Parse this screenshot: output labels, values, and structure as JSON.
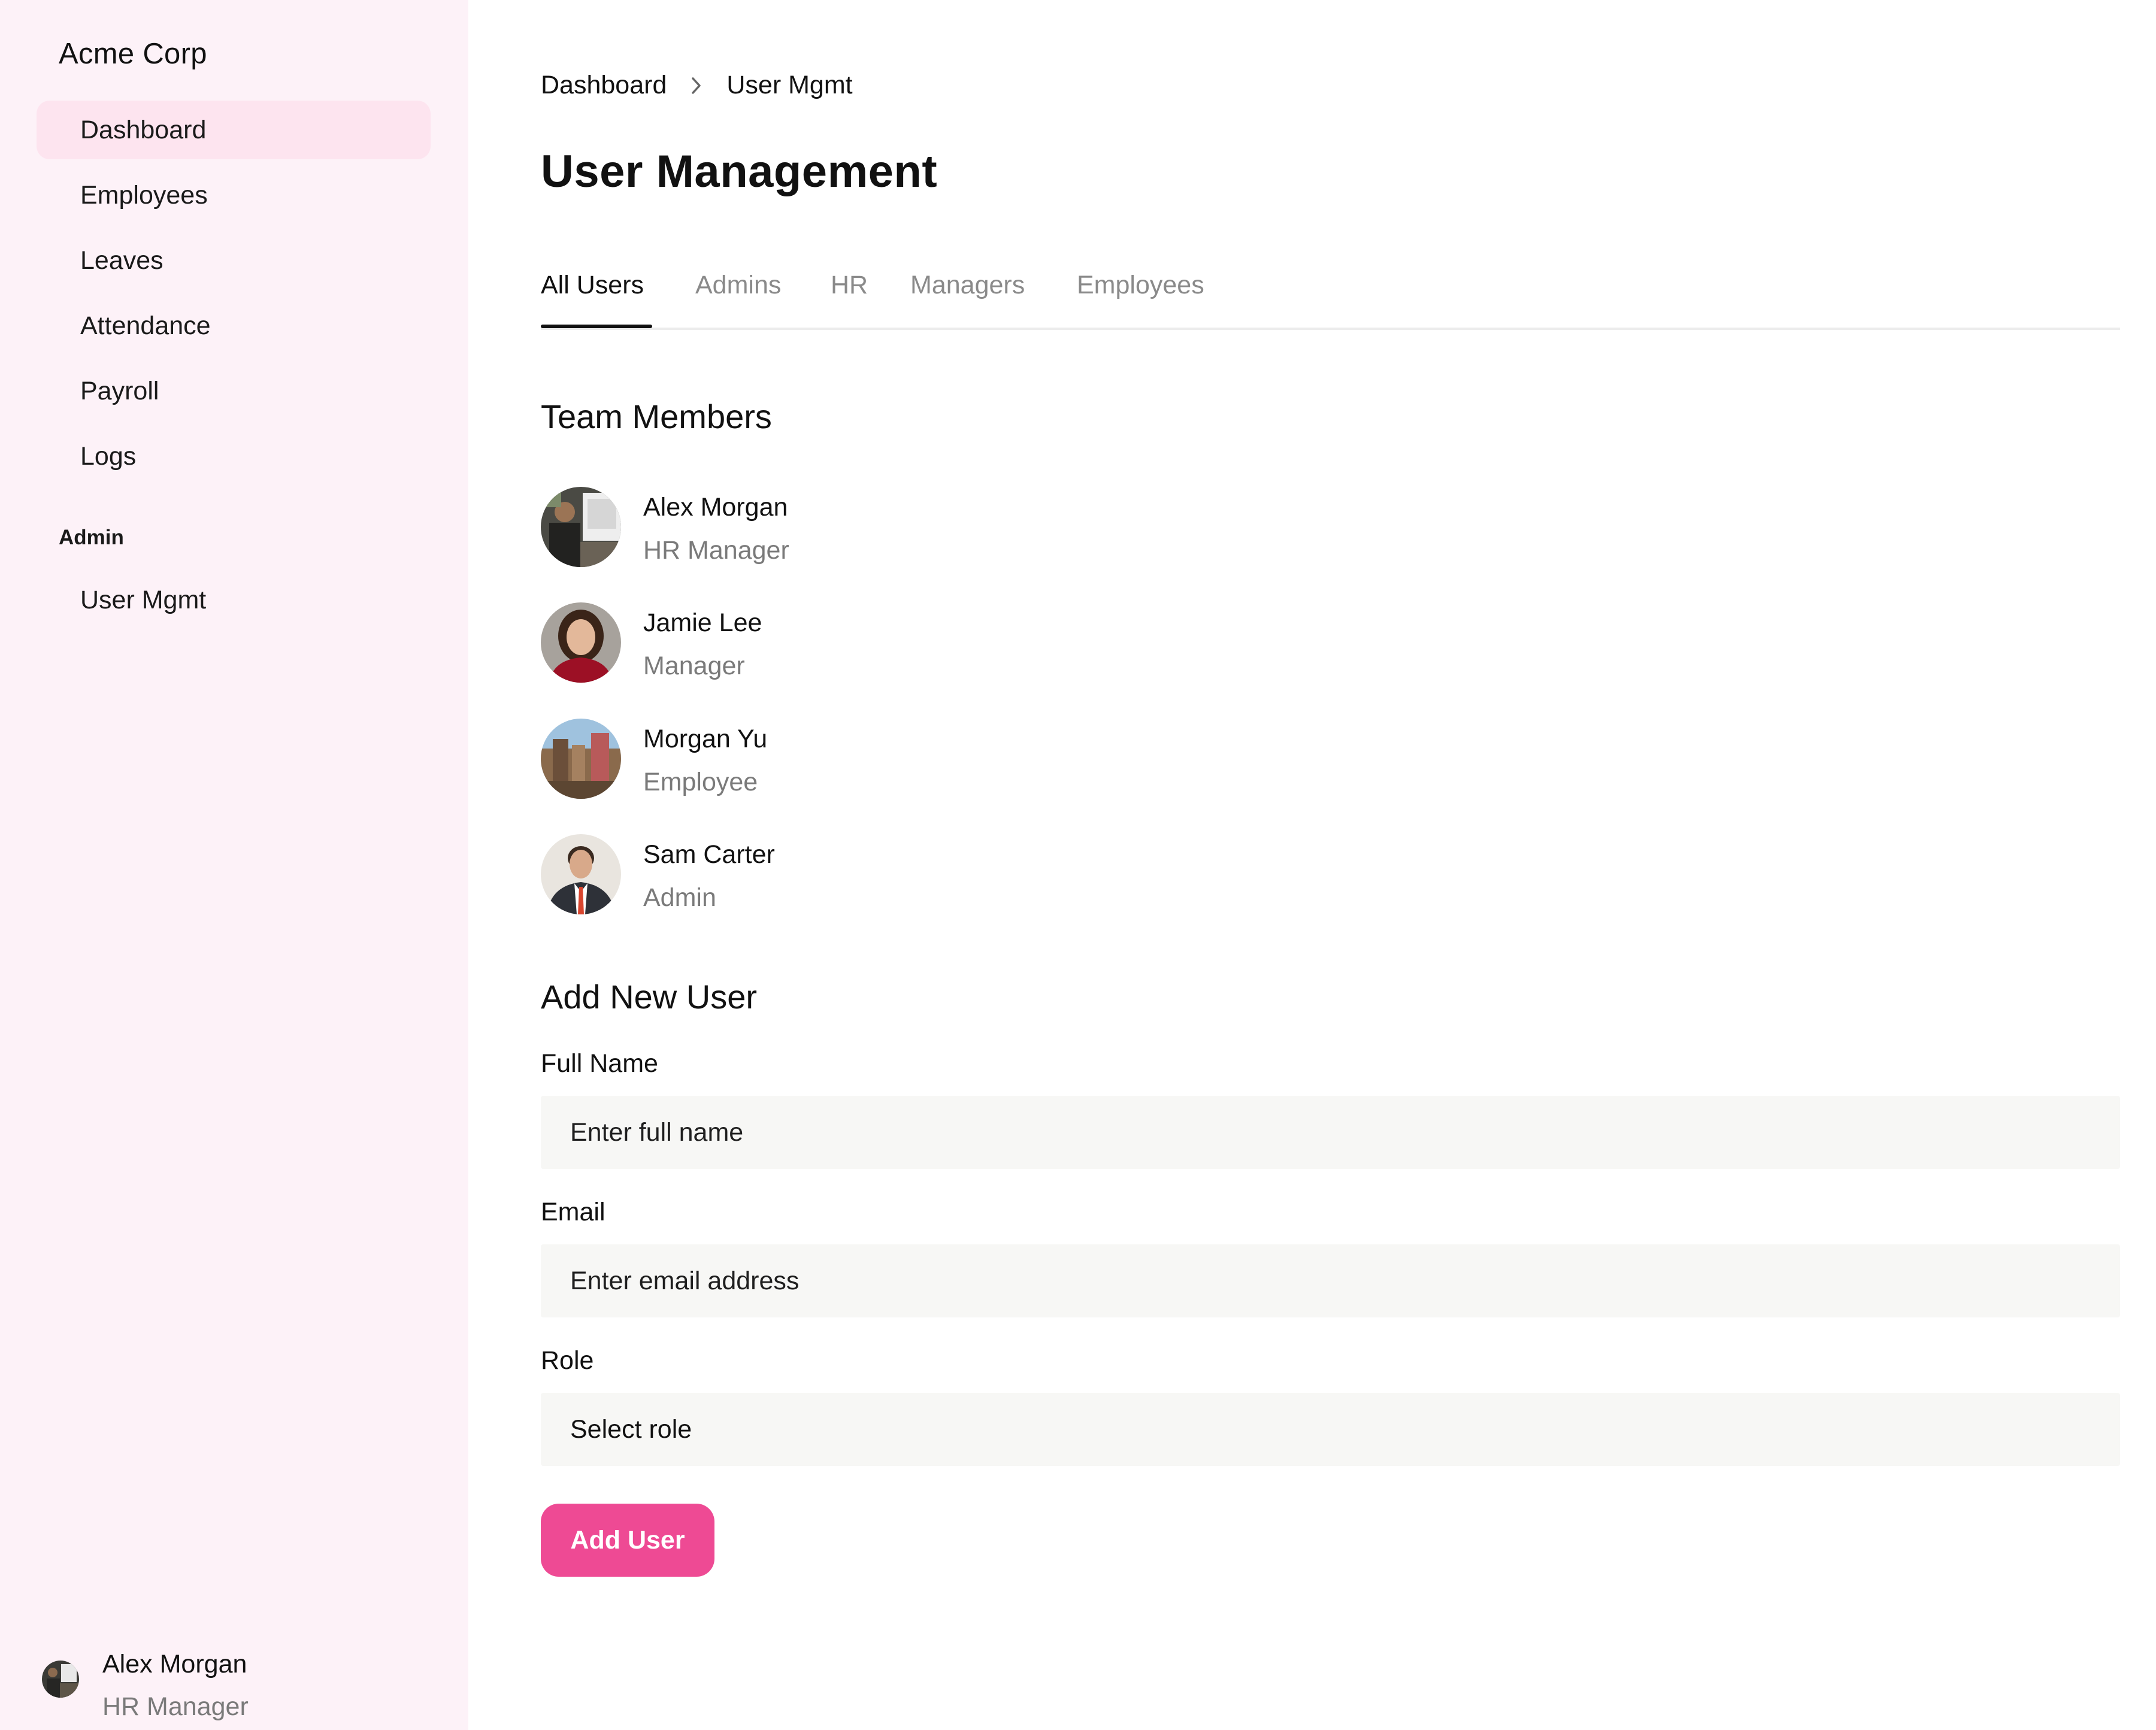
{
  "app": {
    "brand": "Acme Corp"
  },
  "colors": {
    "sidebar_bg": "#fdf2f8",
    "active_item_bg": "#fde4ef",
    "accent": "#ee4a94",
    "input_bg": "#f7f7f5"
  },
  "sidebar": {
    "items": [
      {
        "label": "Dashboard",
        "active": true
      },
      {
        "label": "Employees"
      },
      {
        "label": "Leaves"
      },
      {
        "label": "Attendance"
      },
      {
        "label": "Payroll"
      },
      {
        "label": "Logs"
      }
    ],
    "admin_section": {
      "title": "Admin",
      "items": [
        {
          "label": "User Mgmt"
        }
      ]
    },
    "profile": {
      "name": "Alex Morgan",
      "role": "HR Manager"
    }
  },
  "breadcrumb": {
    "parent": "Dashboard",
    "separator_icon": "chevron-right-icon",
    "current": "User Mgmt"
  },
  "page": {
    "title": "User Management"
  },
  "tabs": [
    {
      "label": "All Users",
      "active": true
    },
    {
      "label": "Admins"
    },
    {
      "label": "HR"
    },
    {
      "label": "Managers"
    },
    {
      "label": "Employees"
    }
  ],
  "team": {
    "title": "Team Members",
    "members": [
      {
        "name": "Alex Morgan",
        "role": "HR Manager"
      },
      {
        "name": "Jamie Lee",
        "role": "Manager"
      },
      {
        "name": "Morgan Yu",
        "role": "Employee"
      },
      {
        "name": "Sam Carter",
        "role": "Admin"
      }
    ]
  },
  "form": {
    "title": "Add New User",
    "full_name": {
      "label": "Full Name",
      "placeholder": "Enter full name",
      "value": ""
    },
    "email": {
      "label": "Email",
      "placeholder": "Enter email address",
      "value": ""
    },
    "role": {
      "label": "Role",
      "selected": "Select role"
    },
    "submit_label": "Add User"
  }
}
